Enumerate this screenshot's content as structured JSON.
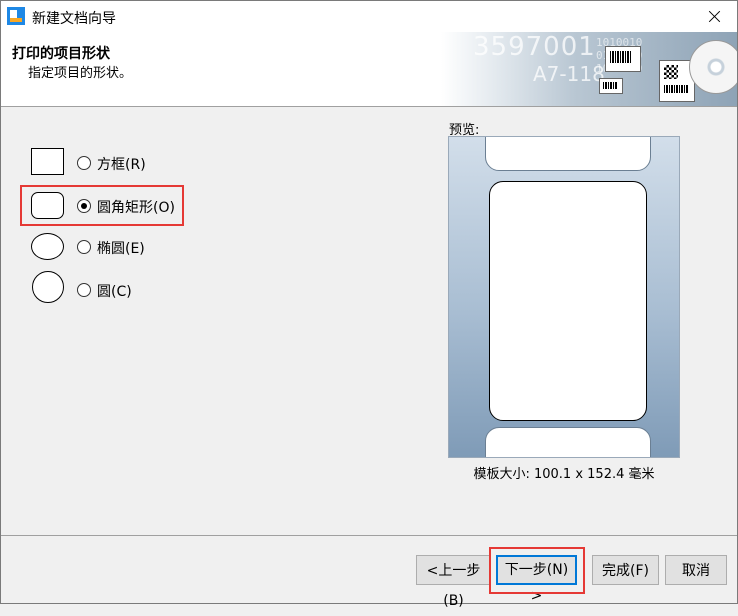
{
  "window": {
    "title": "新建文档向导"
  },
  "header": {
    "title": "打印的项目形状",
    "subtitle": "指定项目的形状。",
    "banner": {
      "number1": "3597001",
      "number2": "A7-118",
      "binary": "1010010\n0110100\n1001010"
    }
  },
  "shapes": [
    {
      "label": "方框(R)",
      "checked": false
    },
    {
      "label": "圆角矩形(O)",
      "checked": true
    },
    {
      "label": "椭圆(E)",
      "checked": false
    },
    {
      "label": "圆(C)",
      "checked": false
    }
  ],
  "preview": {
    "label": "预览:",
    "size_text": "模板大小: 100.1 x 152.4 毫米"
  },
  "buttons": {
    "back": "<上一步(B)",
    "next": "下一步(N) >",
    "finish": "完成(F)",
    "cancel": "取消"
  },
  "colors": {
    "highlight": "#e53935",
    "focus": "#0078d7"
  }
}
